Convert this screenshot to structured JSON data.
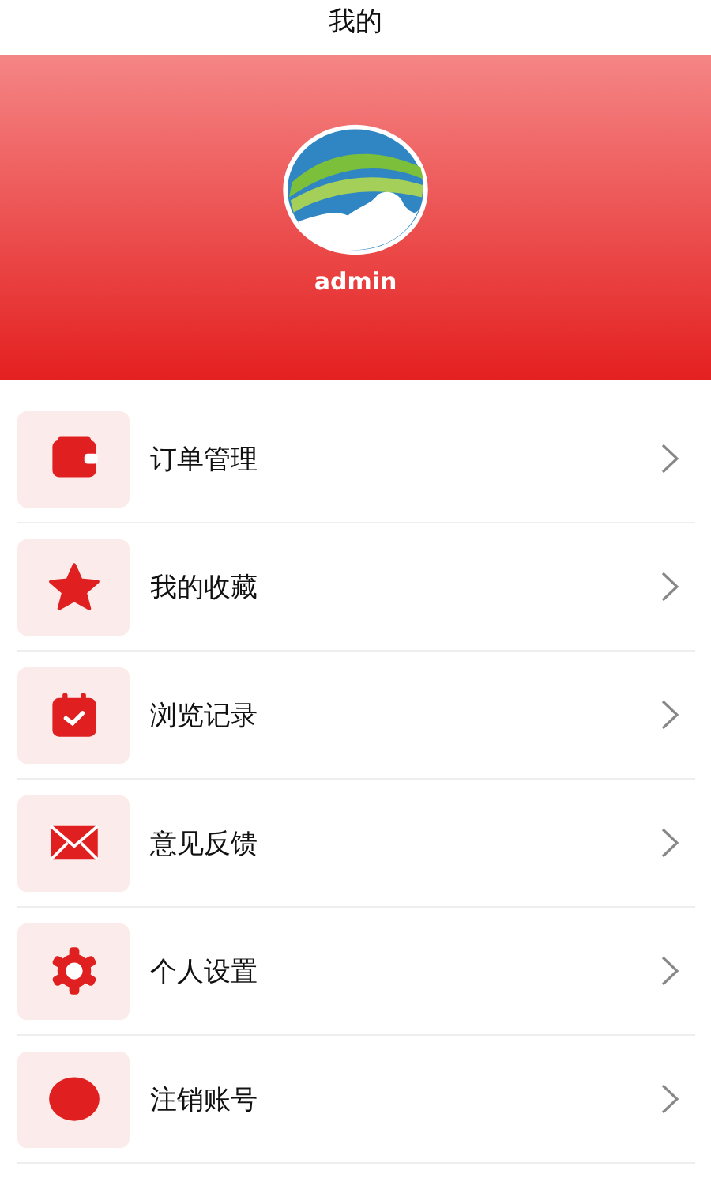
{
  "title": "我的",
  "profile": {
    "username": "admin"
  },
  "menu": [
    {
      "kind": "wallet",
      "label": "订单管理"
    },
    {
      "kind": "star",
      "label": "我的收藏"
    },
    {
      "kind": "calendar",
      "label": "浏览记录"
    },
    {
      "kind": "mail",
      "label": "意见反馈"
    },
    {
      "kind": "gear",
      "label": "个人设置"
    },
    {
      "kind": "circle",
      "label": "注销账号"
    }
  ]
}
